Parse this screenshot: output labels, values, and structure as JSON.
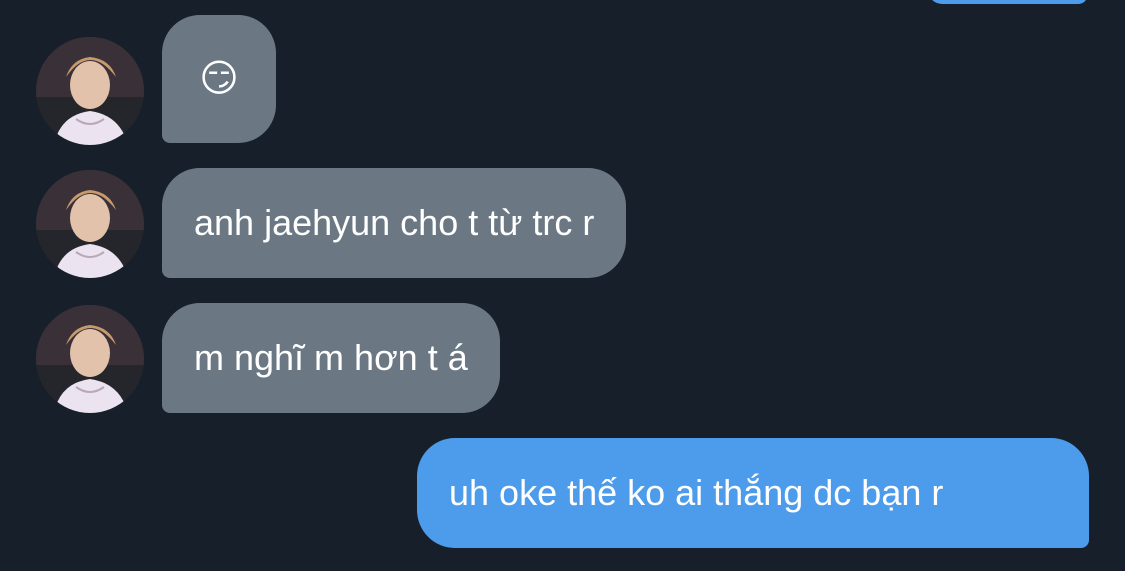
{
  "conversation": {
    "messages": [
      {
        "sender": "other",
        "text": "😏"
      },
      {
        "sender": "other",
        "text": "anh jaehyun cho t từ trc r"
      },
      {
        "sender": "other",
        "text": "m nghĩ m hơn t á"
      },
      {
        "sender": "me",
        "text": "uh oke thế ko ai thắng dc bạn r"
      }
    ]
  },
  "colors": {
    "background": "#17202a",
    "incoming_bubble": "#6b7884",
    "outgoing_bubble": "#4c9ceb",
    "text": "#ffffff"
  },
  "icons": {
    "avatar": "profile-photo-avatar"
  }
}
